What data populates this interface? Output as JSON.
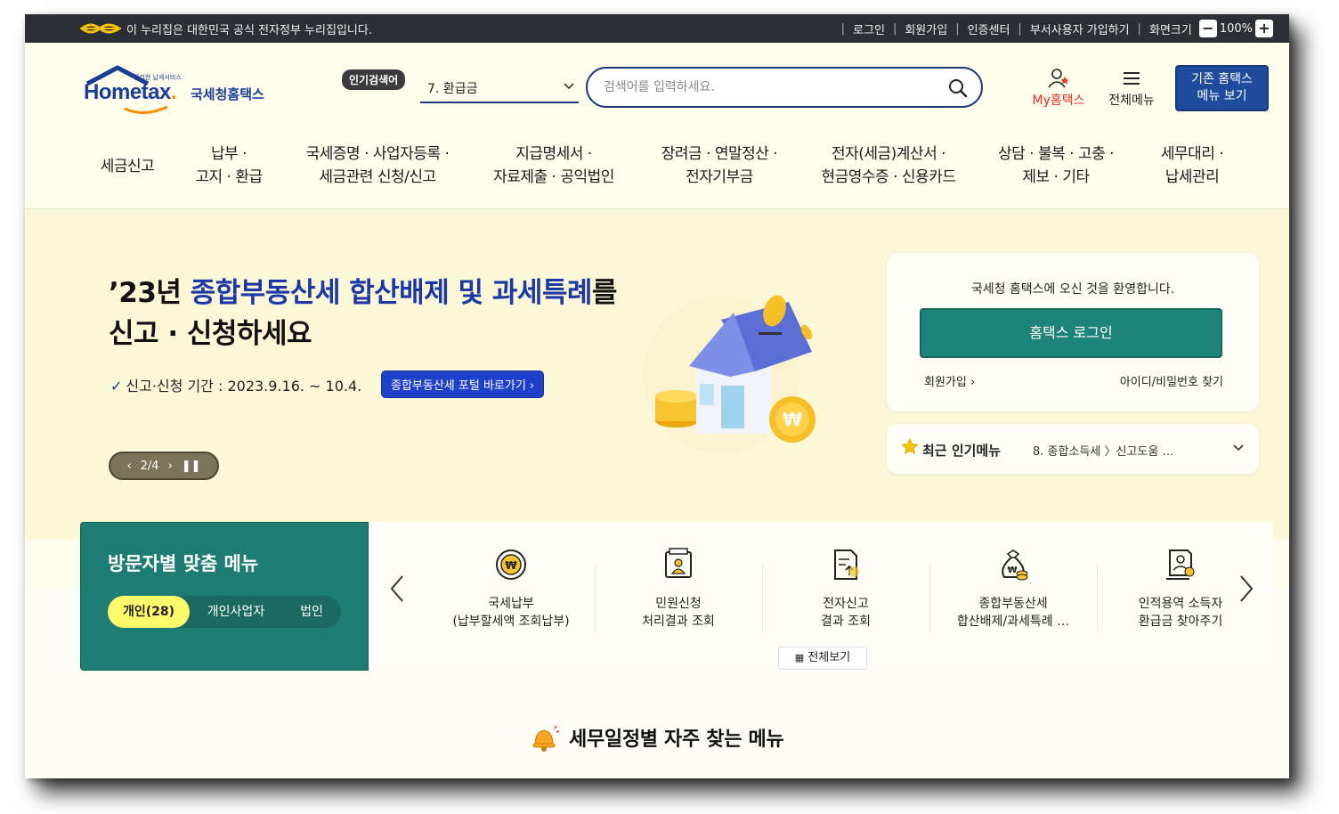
{
  "topbar": {
    "gov_notice": "이 누리집은 대한민국 공식 전자정부 누리집입니다.",
    "links": [
      "로그인",
      "회원가입",
      "인증센터",
      "부서사용자 가입하기",
      "화면크기"
    ],
    "zoom": "100%",
    "zoom_minus": "−",
    "zoom_plus": "+"
  },
  "header": {
    "logo_sub": "편리한 납세서비스",
    "logo_main": "Hometax",
    "logo_kr": "국세청홈택스",
    "popular_badge": "인기검색어",
    "popular_value": "7.  환급금",
    "search_placeholder": "검색어를 입력하세요.",
    "my_label": "My홈택스",
    "allmenu_label": "전체메뉴",
    "old_hometax": [
      "기존 홈택스",
      "메뉴 보기"
    ]
  },
  "gnb": [
    {
      "line1": "세금신고",
      "line2": ""
    },
    {
      "line1": "납부 ·",
      "line2": "고지 · 환급"
    },
    {
      "line1": "국세증명 · 사업자등록 ·",
      "line2": "세금관련 신청/신고"
    },
    {
      "line1": "지급명세서 ·",
      "line2": "자료제출 · 공익법인"
    },
    {
      "line1": "장려금 · 연말정산 ·",
      "line2": "전자기부금"
    },
    {
      "line1": "전자(세금)계산서 ·",
      "line2": "현금영수증 · 신용카드"
    },
    {
      "line1": "상담 · 불복 · 고충 ·",
      "line2": "제보 · 기타"
    },
    {
      "line1": "세무대리 ·",
      "line2": "납세관리"
    }
  ],
  "hero": {
    "title_prefix": "’23년 ",
    "title_highlight": "종합부동산세 합산배제 및 과세특례",
    "title_suffix": "를",
    "title_line2": "신고 · 신청하세요",
    "period": "신고·신청 기간 : 2023.9.16. ~ 10.4.",
    "portal_button": "종합부동산세 포털 바로가기 ›",
    "pager": "2/4"
  },
  "login": {
    "welcome": "국세청 홈택스에 오신 것을 환영합니다.",
    "button": "홈택스 로그인",
    "join": "회원가입",
    "find": "아이디/비밀번호 찾기"
  },
  "popular_menu": {
    "label": "최근 인기메뉴",
    "value": "8.  종합소득세 〉신고도움 …"
  },
  "visitor": {
    "title": "방문자별 맞춤 메뉴",
    "tabs": [
      "개인(28)",
      "개인사업자",
      "법인"
    ]
  },
  "quick_menu": [
    {
      "icon": "won-coin-icon",
      "line1": "국세납부",
      "line2": "(납부할세액 조회납부)"
    },
    {
      "icon": "document-person-icon",
      "line1": "민원신청",
      "line2": "처리결과 조회"
    },
    {
      "icon": "document-upload-icon",
      "line1": "전자신고",
      "line2": "결과 조회"
    },
    {
      "icon": "money-bag-icon",
      "line1": "종합부동산세",
      "line2": "합산배제/과세특례 …"
    },
    {
      "icon": "document-refund-icon",
      "line1": "인적용역 소득자",
      "line2": "환급금 찾아주기"
    }
  ],
  "see_all": "전체보기",
  "schedule_title": "세무일정별 자주 찾는 메뉴",
  "colors": {
    "topbar": "#2b2e33",
    "brand_blue": "#1a3e98",
    "teal": "#1e7d72",
    "login_green": "#1e8378",
    "hero_bg": "#fcf7d6",
    "highlight_blue": "#1c38a6",
    "my_red": "#e5332a"
  }
}
